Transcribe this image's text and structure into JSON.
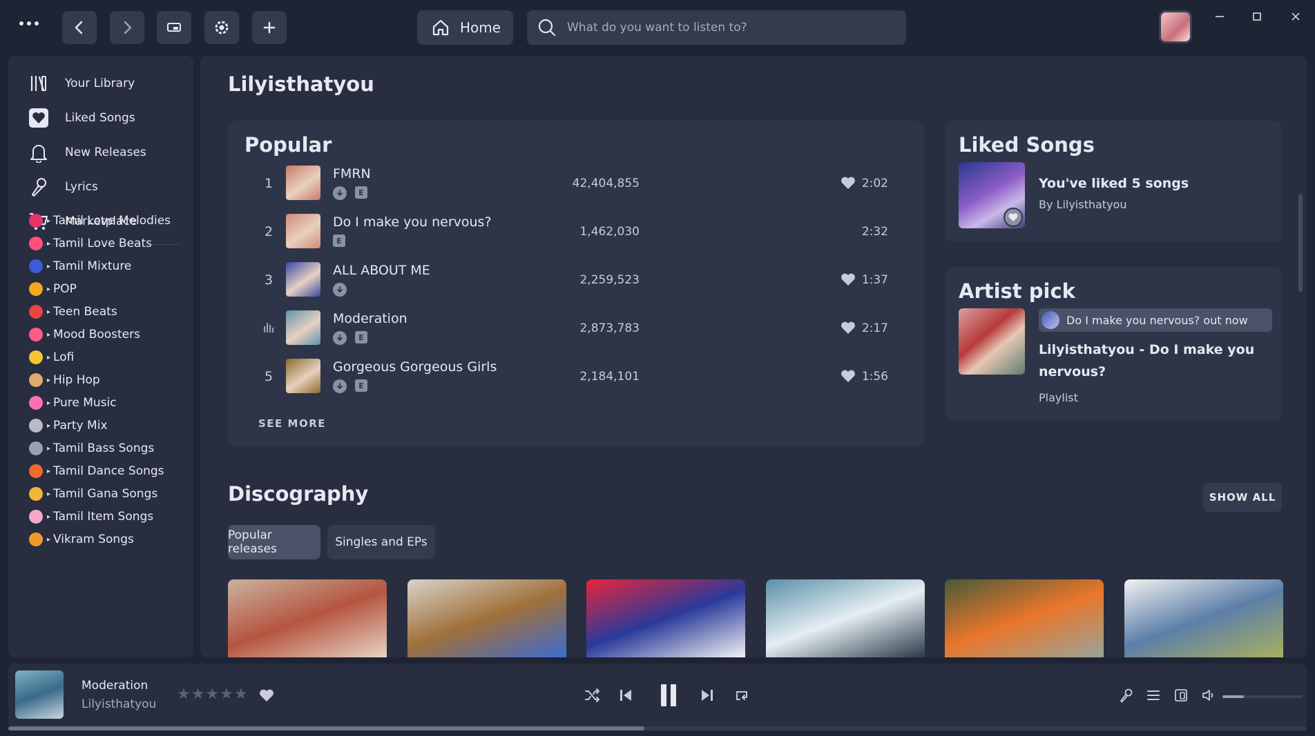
{
  "topbar": {
    "home_label": "Home",
    "search_placeholder": "What do you want to listen to?"
  },
  "sidebar": {
    "nav": [
      {
        "label": "Your Library",
        "icon": "library-icon"
      },
      {
        "label": "Liked Songs",
        "icon": "heart-square-icon"
      },
      {
        "label": "New Releases",
        "icon": "bell-icon"
      },
      {
        "label": "Lyrics",
        "icon": "microphone-icon"
      },
      {
        "label": "Marketplace",
        "icon": "cart-icon"
      }
    ],
    "playlists": [
      {
        "label": "Tamil Love Melodies",
        "color": "#e8336b"
      },
      {
        "label": "Tamil Love Beats",
        "color": "#ff4f7a"
      },
      {
        "label": "Tamil Mixture",
        "color": "#3b5bdb"
      },
      {
        "label": "POP",
        "color": "#f5a623"
      },
      {
        "label": "Teen Beats",
        "color": "#e84545"
      },
      {
        "label": "Mood Boosters",
        "color": "#ff5c8a"
      },
      {
        "label": "Lofi",
        "color": "#f7c531"
      },
      {
        "label": "Hip Hop",
        "color": "#e0a96d"
      },
      {
        "label": "Pure Music",
        "color": "#ff6fb5"
      },
      {
        "label": "Party Mix",
        "color": "#b8bcc8"
      },
      {
        "label": "Tamil Bass Songs",
        "color": "#9aa1b3"
      },
      {
        "label": "Tamil Dance Songs",
        "color": "#f06a2e"
      },
      {
        "label": "Tamil Gana Songs",
        "color": "#f5b53a"
      },
      {
        "label": "Tamil Item Songs",
        "color": "#f7a8c8"
      },
      {
        "label": "Vikram Songs",
        "color": "#f09a2e"
      }
    ]
  },
  "artist": {
    "name": "Lilyisthatyou"
  },
  "popular": {
    "title": "Popular",
    "see_more": "SEE MORE",
    "tracks": [
      {
        "num": "1",
        "name": "FMRN",
        "plays": "42,404,855",
        "duration": "2:02",
        "downloaded": true,
        "explicit": true,
        "liked": true,
        "art": "#c97a6a"
      },
      {
        "num": "2",
        "name": "Do I make you nervous?",
        "plays": "1,462,030",
        "duration": "2:32",
        "downloaded": false,
        "explicit": true,
        "liked": false,
        "art": "#d28a78"
      },
      {
        "num": "3",
        "name": "ALL ABOUT ME",
        "plays": "2,259,523",
        "duration": "1:37",
        "downloaded": true,
        "explicit": false,
        "liked": true,
        "art": "#3a4aa8"
      },
      {
        "num": "",
        "name": "Moderation",
        "plays": "2,873,783",
        "duration": "2:17",
        "downloaded": true,
        "explicit": true,
        "liked": true,
        "art": "#5f94ad",
        "playing": true
      },
      {
        "num": "5",
        "name": "Gorgeous Gorgeous Girls",
        "plays": "2,184,101",
        "duration": "1:56",
        "downloaded": true,
        "explicit": true,
        "liked": true,
        "art": "#8a6a2a"
      }
    ],
    "explicit_letter": "E"
  },
  "liked_songs": {
    "title": "Liked Songs",
    "summary": "You've liked 5 songs",
    "by": "By Lilyisthatyou"
  },
  "artist_pick": {
    "title": "Artist pick",
    "pill": "Do I make you nervous? out now",
    "name": "Lilyisthatyou - Do I make you nervous?",
    "type": "Playlist"
  },
  "discography": {
    "title": "Discography",
    "show_all": "SHOW ALL",
    "tabs": [
      {
        "label": "Popular releases",
        "active": true
      },
      {
        "label": "Singles and EPs",
        "active": false
      }
    ],
    "albums": [
      {
        "colors": [
          "#c9b3a0",
          "#b5553f",
          "#e7d3c3"
        ]
      },
      {
        "colors": [
          "#d8d4cc",
          "#a0703a",
          "#3d6bd0"
        ]
      },
      {
        "colors": [
          "#e8253a",
          "#2a3a9a",
          "#f2f2f2"
        ]
      },
      {
        "colors": [
          "#5a8fa8",
          "#e5eef2",
          "#2a3a48"
        ]
      },
      {
        "colors": [
          "#4a5a3a",
          "#e8762a",
          "#9aa49a"
        ]
      },
      {
        "colors": [
          "#f2f2f2",
          "#5d7fa8",
          "#a8b060"
        ]
      }
    ]
  },
  "player": {
    "title": "Moderation",
    "artist": "Lilyisthatyou",
    "stars": "★★★★★",
    "volume_fraction": 0.27,
    "progress_fraction": 0.49
  },
  "colors": {
    "background": "#1f2434",
    "panel": "#282e3f",
    "card": "#2f3548",
    "button": "#343b4e",
    "text": "#e6e9f2",
    "muted": "#a6acbd"
  }
}
